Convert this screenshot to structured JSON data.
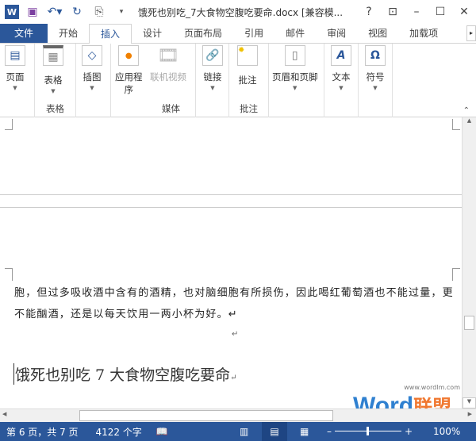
{
  "window": {
    "title": "饿死也别吃_7大食物空腹吃要命.docx [兼容模...",
    "help": "?",
    "restore_ribbon": "⊡",
    "minimize": "–",
    "maximize": "☐",
    "close": "✕"
  },
  "tabs": [
    {
      "label": "文件"
    },
    {
      "label": "开始"
    },
    {
      "label": "插入"
    },
    {
      "label": "设计"
    },
    {
      "label": "页面布局"
    },
    {
      "label": "引用"
    },
    {
      "label": "邮件"
    },
    {
      "label": "审阅"
    },
    {
      "label": "视图"
    },
    {
      "label": "加载项"
    }
  ],
  "ribbon": {
    "pages": "页面",
    "table": "表格",
    "table_group": "表格",
    "illustrations": "插图",
    "apps_line1": "应用程",
    "apps_line2": "序",
    "online_video": "联机视频",
    "media_group": "媒体",
    "links": "链接",
    "comment": "批注",
    "comment_group": "批注",
    "header_footer": "页眉和页脚",
    "text": "文本",
    "symbols": "符号",
    "symbol_glyph": "Ω",
    "text_glyph": "A"
  },
  "document": {
    "paragraph": "胞，但过多吸收酒中含有的酒精，也对脑细胞有所损伤，因此喝红葡萄酒也不能过量，更不能酗酒，还是以每天饮用一两小杯为好。↵",
    "empty_mark": "↵",
    "heading": "饿死也别吃 7 大食物空腹吃要命",
    "heading_mark": "↵",
    "watermark_word": "Word",
    "watermark_cn": "联盟",
    "watermark_url": "www.wordlm.com"
  },
  "status": {
    "page": "第 6 页，共 7 页",
    "words": "4122 个字",
    "zoom": "100%"
  }
}
